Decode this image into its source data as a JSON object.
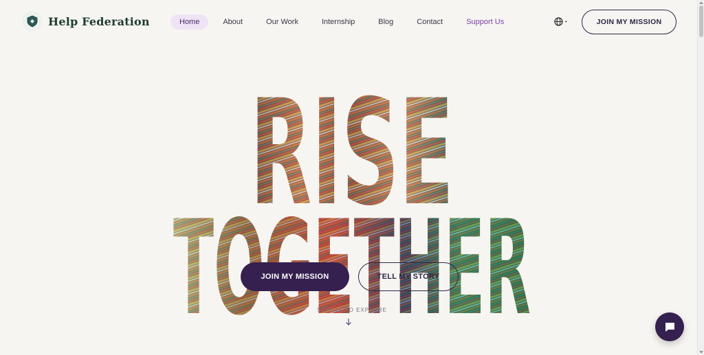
{
  "brand": {
    "name": "Help Federation"
  },
  "nav": {
    "items": [
      {
        "label": "Home",
        "active": true
      },
      {
        "label": "About"
      },
      {
        "label": "Our Work"
      },
      {
        "label": "Internship"
      },
      {
        "label": "Blog"
      },
      {
        "label": "Contact"
      },
      {
        "label": "Support Us",
        "highlight": true
      }
    ]
  },
  "header": {
    "cta_label": "JOIN MY MISSION",
    "language_icon": "globe-icon"
  },
  "hero": {
    "headline_line1": "RISE",
    "headline_line2": "TOGETHER",
    "primary_button": "JOIN MY MISSION",
    "secondary_button": "TELL MY STORY",
    "scroll_hint": "SCROLL TO EXPLORE",
    "scroll_icon": "arrow-down-icon"
  },
  "chat": {
    "icon": "chat-bubble-icon"
  },
  "colors": {
    "brand_dark": "#35204f",
    "nav_active_bg": "#efe4f6",
    "support_link": "#7a3fa6",
    "logo_green": "#1f3b2f",
    "page_bg": "#f7f5f2"
  }
}
